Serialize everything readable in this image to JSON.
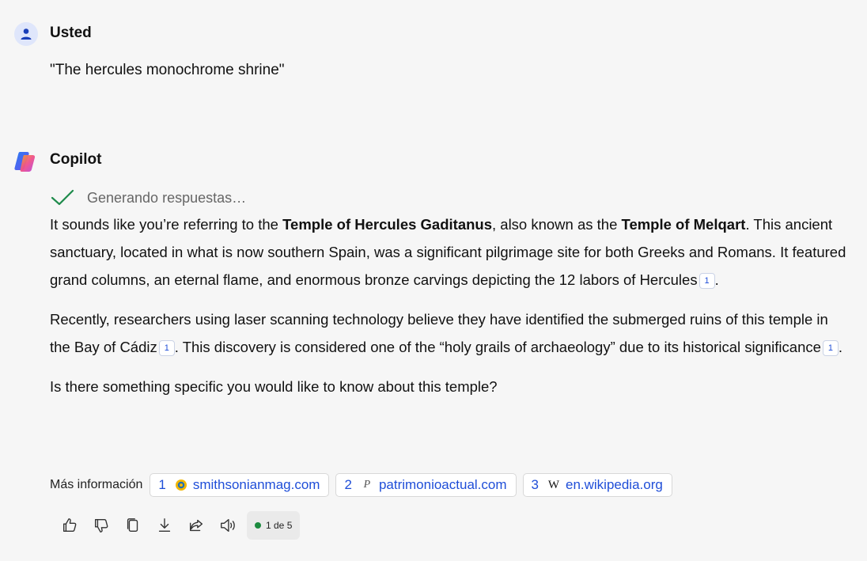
{
  "user": {
    "name": "Usted",
    "message": "\"The hercules monochrome shrine\""
  },
  "copilot": {
    "name": "Copilot",
    "status": "Generando respuestas…",
    "para1": {
      "t1": "It sounds like you’re referring to the ",
      "b1": "Temple of Hercules Gaditanus",
      "t2": ", also known as the ",
      "b2": "Temple of Melqart",
      "t3": ". This ancient sanctuary, located in what is now southern Spain, was a significant pilgrimage site for both Greeks and Romans. It featured grand columns, an eternal flame, and enormous bronze carvings depicting the 12 labors of Hercules",
      "cite": "1",
      "t4": "."
    },
    "para2": {
      "t1": "Recently, researchers using laser scanning technology believe they have identified the submerged ruins of this temple in the Bay of Cádiz",
      "cite1": "1",
      "t2": ". This discovery is considered one of the “holy grails of archaeology” due to its historical significance",
      "cite2": "1",
      "t3": "."
    },
    "para3": "Is there something specific you would like to know about this temple?"
  },
  "more_info": {
    "label": "Más información",
    "sources": [
      {
        "num": "1",
        "domain": "smithsonianmag.com",
        "icon": "smithsonian-icon"
      },
      {
        "num": "2",
        "domain": "patrimonioactual.com",
        "icon": "patrimonio-icon",
        "glyph": "P"
      },
      {
        "num": "3",
        "domain": "en.wikipedia.org",
        "icon": "wikipedia-icon",
        "glyph": "W"
      }
    ]
  },
  "toolbar": {
    "page_indicator": "1 de 5",
    "icons": [
      "thumbs-up-icon",
      "thumbs-down-icon",
      "copy-icon",
      "download-icon",
      "share-icon",
      "read-aloud-icon"
    ]
  },
  "colors": {
    "background": "#f6f6f6",
    "link": "#1f4ed8",
    "status_green": "#1b8a3e",
    "check_green": "#1f8b4c"
  }
}
